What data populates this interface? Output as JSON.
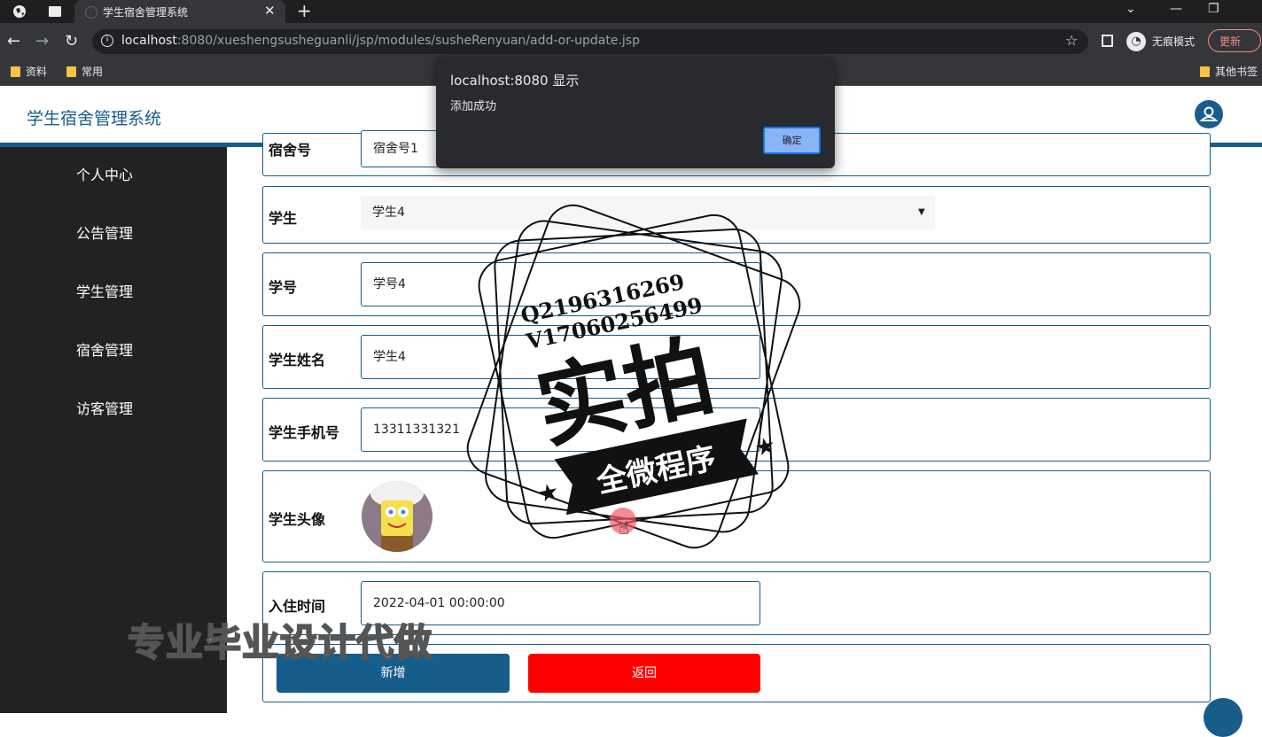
{
  "browser": {
    "tab_title": "学生宿舍管理系统",
    "url_host": "localhost",
    "url_rest": ":8080/xueshengsusheguanli/jsp/modules/susheRenyuan/add-or-update.jsp",
    "incognito_label": "无痕模式",
    "update_label": "更新",
    "bookmarks": [
      "资料",
      "常用"
    ],
    "other_bookmarks": "其他书签"
  },
  "app": {
    "title": "学生宿舍管理系统"
  },
  "sidebar": {
    "items": [
      {
        "label": "个人中心"
      },
      {
        "label": "公告管理"
      },
      {
        "label": "学生管理"
      },
      {
        "label": "宿舍管理"
      },
      {
        "label": "访客管理"
      }
    ]
  },
  "form": {
    "dorm": {
      "label": "宿舍号",
      "value": "宿舍号1"
    },
    "student": {
      "label": "学生",
      "value": "学生4"
    },
    "student_no": {
      "label": "学号",
      "value": "学号4"
    },
    "student_name": {
      "label": "学生姓名",
      "value": "学生4"
    },
    "student_phone": {
      "label": "学生手机号",
      "value": "13311331321"
    },
    "student_avatar": {
      "label": "学生头像"
    },
    "checkin_time": {
      "label": "入住时间",
      "value": "2022-04-01 00:00:00"
    },
    "add_button": "新增",
    "back_button": "返回"
  },
  "dialog": {
    "title": "localhost:8080 显示",
    "message": "添加成功",
    "ok_label": "确定"
  },
  "overlay": {
    "stamp_line1": "Q2196316269",
    "stamp_line2": "V17060256499",
    "stamp_main": "实拍",
    "stamp_banner": "全微程序",
    "bottom_text": "专业毕业设计代做"
  },
  "colors": {
    "primary": "#175d8c",
    "danger": "#ff0000",
    "sidebar": "#222222"
  }
}
